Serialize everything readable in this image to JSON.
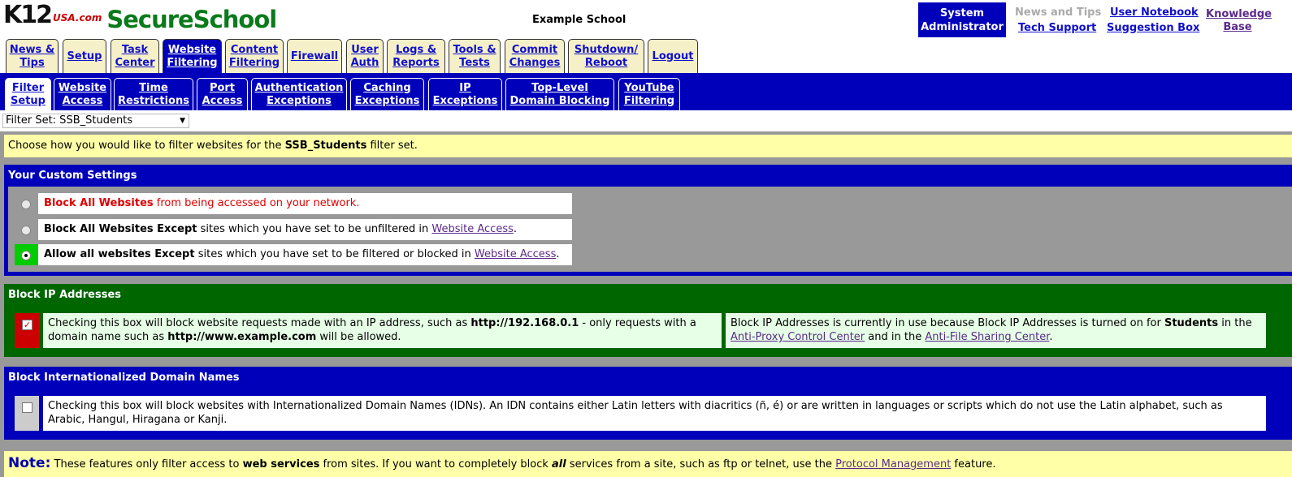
{
  "header": {
    "logo_k12": "K12",
    "logo_usa": "USA.com",
    "logo_brand": "SecureSchool",
    "school_name": "Example School",
    "user_role_line1": "System",
    "user_role_line2": "Administrator",
    "links": {
      "news_tips": "News and Tips",
      "tech_support": "Tech Support",
      "user_notebook": "User Notebook",
      "suggestion_box": "Suggestion Box",
      "knowledge_base_1": "Knowledge",
      "knowledge_base_2": "Base"
    }
  },
  "main_tabs": [
    {
      "line1": "News &",
      "line2": "Tips"
    },
    {
      "line1": "Setup",
      "line2": ""
    },
    {
      "line1": "Task",
      "line2": "Center"
    },
    {
      "line1": "Website",
      "line2": "Filtering",
      "active": true
    },
    {
      "line1": "Content",
      "line2": "Filtering"
    },
    {
      "line1": "Firewall",
      "line2": ""
    },
    {
      "line1": "User",
      "line2": "Auth"
    },
    {
      "line1": "Logs &",
      "line2": "Reports"
    },
    {
      "line1": "Tools &",
      "line2": "Tests"
    },
    {
      "line1": "Commit",
      "line2": "Changes"
    },
    {
      "line1": "Shutdown/",
      "line2": "Reboot"
    },
    {
      "line1": "Logout",
      "line2": ""
    }
  ],
  "sub_tabs": [
    {
      "line1": "Filter",
      "line2": "Setup",
      "active": true
    },
    {
      "line1": "Website",
      "line2": "Access"
    },
    {
      "line1": "Time",
      "line2": "Restrictions"
    },
    {
      "line1": "Port",
      "line2": "Access"
    },
    {
      "line1": "Authentication",
      "line2": "Exceptions"
    },
    {
      "line1": "Caching",
      "line2": "Exceptions"
    },
    {
      "line1": "IP",
      "line2": "Exceptions"
    },
    {
      "line1": "Top-Level",
      "line2": "Domain Blocking"
    },
    {
      "line1": "YouTube",
      "line2": "Filtering"
    }
  ],
  "filter_set": {
    "label": "Filter Set: SSB_Students",
    "selected": "SSB_Students"
  },
  "intro": {
    "prefix": "Choose how you would like to filter websites for the ",
    "set_name": "SSB_Students",
    "suffix": " filter set."
  },
  "custom_settings": {
    "title": "Your Custom Settings",
    "options": [
      {
        "bold": "Block All Websites",
        "text": " from being accessed on your network.",
        "link": "",
        "end": "",
        "checked": false
      },
      {
        "bold": "Block All Websites Except",
        "text": " sites which you have set to be unfiltered in ",
        "link": "Website Access",
        "end": ".",
        "checked": false
      },
      {
        "bold": "Allow all websites Except",
        "text": " sites which you have set to be filtered or blocked in ",
        "link": "Website Access",
        "end": ".",
        "checked": true
      }
    ]
  },
  "block_ip": {
    "title": "Block IP Addresses",
    "checked": true,
    "desc_1": "Checking this box will block website requests made with an IP address, such as ",
    "desc_ip": "http://192.168.0.1",
    "desc_2": " - only requests with a domain name such as ",
    "desc_domain": "http://www.example.com",
    "desc_3": " will be allowed.",
    "status_1": "Block IP Addresses is currently in use because Block IP Addresses is turned on for ",
    "status_group": "Students",
    "status_2": " in the ",
    "status_link1": "Anti-Proxy Control Center",
    "status_3": " and in the ",
    "status_link2": "Anti-File Sharing Center",
    "status_4": "."
  },
  "block_idn": {
    "title": "Block Internationalized Domain Names",
    "checked": false,
    "desc": "Checking this box will block websites with Internationalized Domain Names (IDNs). An IDN contains either Latin letters with diacritics (ñ, é) or are written in languages or scripts which do not use the Latin alphabet, such as Arabic, Hangul, Hiragana or Kanji."
  },
  "note": {
    "label": "Note:",
    "text_1": " These features only filter access to ",
    "bold_1": "web services",
    "text_2": " from sites. If you want to completely block ",
    "bold_2": "all",
    "text_3": " services from a site, such as ftp or telnet, use the ",
    "link": "Protocol Management",
    "text_4": " feature."
  },
  "colors": {
    "nav_blue": "#0000bb",
    "section_green": "#006600",
    "highlight_green": "#00cc00",
    "check_red": "#cc0000",
    "note_yellow": "#ffffa8",
    "tab_cream": "#f5f0c8"
  }
}
